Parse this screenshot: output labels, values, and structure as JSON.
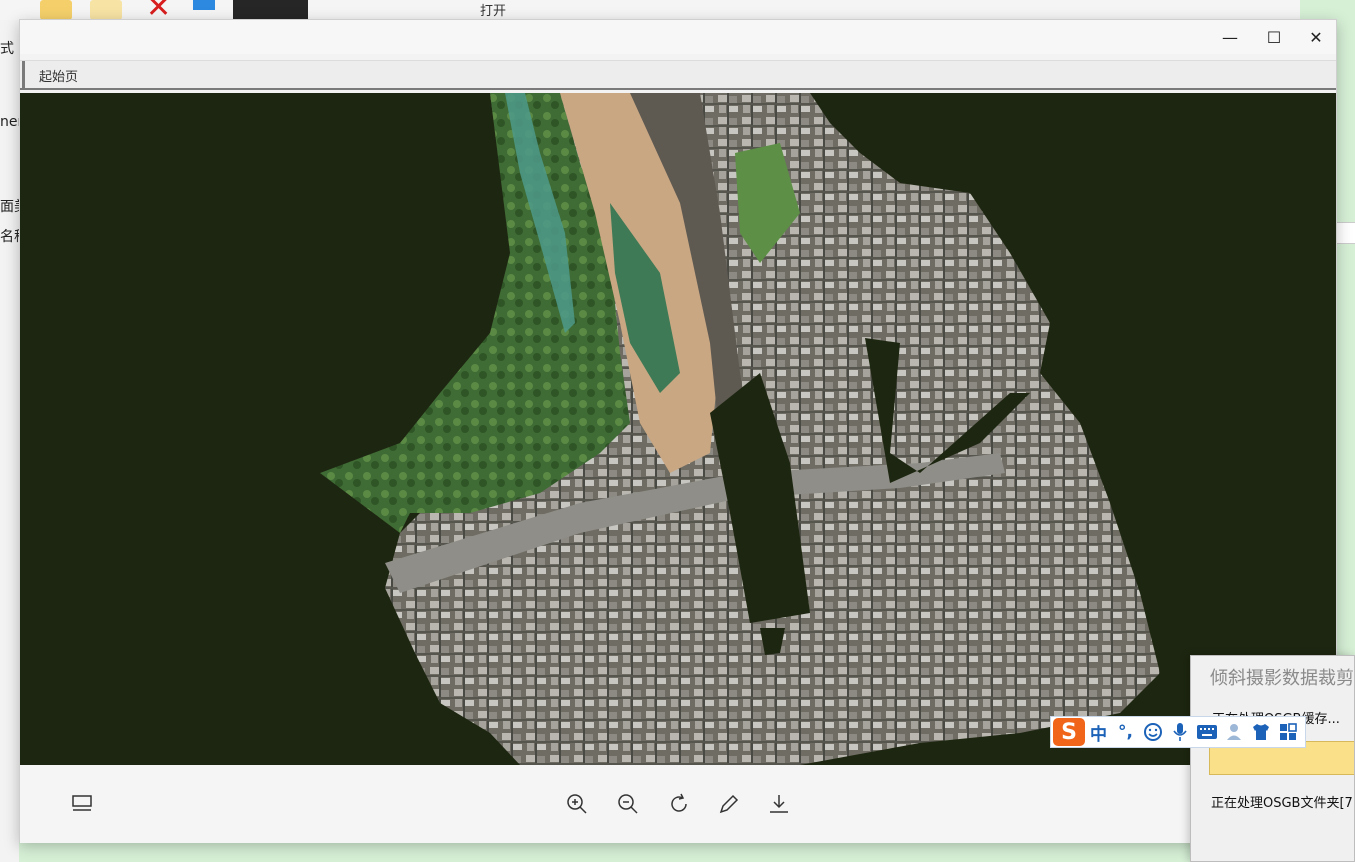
{
  "background": {
    "open_label": "打开",
    "left_fragments": [
      "式",
      "ner",
      "面美",
      "名称"
    ]
  },
  "viewer": {
    "tab_label": "起始页",
    "window_controls": {
      "minimize": "—",
      "maximize": "☐",
      "close": "✕"
    },
    "canvas_color": "#1d2610",
    "toolbar_icons": [
      "slideshow-icon",
      "zoom-in-icon",
      "zoom-out-icon",
      "rotate-icon",
      "edit-icon",
      "save-icon"
    ]
  },
  "dialog": {
    "title": "倾斜摄影数据裁剪",
    "status": "正在处理OSGB缓存...",
    "folder": "正在处理OSGB文件夹[7"
  },
  "ime": {
    "logo": "S",
    "items": [
      "中",
      "°,",
      "☺",
      "mic",
      "kbd",
      "user",
      "shirt",
      "grid"
    ]
  },
  "colors": {
    "accent": "#f0651a",
    "ime_blue": "#1b62b8",
    "progress": "#fbe08a"
  }
}
